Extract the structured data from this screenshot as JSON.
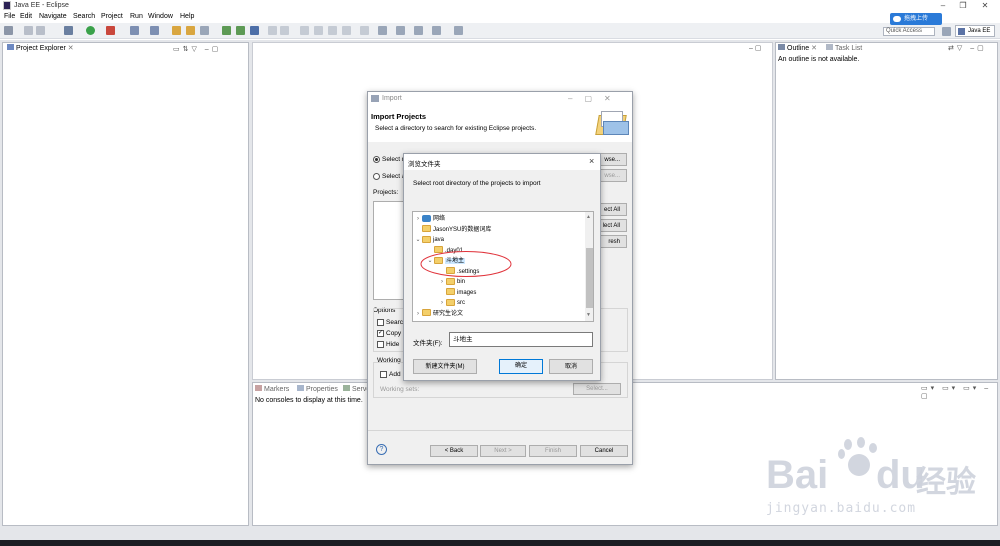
{
  "window": {
    "title": "Java EE - Eclipse"
  },
  "menu": [
    "File",
    "Edit",
    "Navigate",
    "Search",
    "Project",
    "Run",
    "Window",
    "Help"
  ],
  "toolbar": {
    "quick_access_placeholder": "Quick Access",
    "perspective": "Java EE",
    "upload_badge": "拖拽上传"
  },
  "project_explorer": {
    "title": "Project Explorer"
  },
  "outline": {
    "tab_outline": "Outline",
    "tab_tasks": "Task List",
    "message": "An outline is not available."
  },
  "console": {
    "tab_markers": "Markers",
    "tab_properties": "Properties",
    "tab_servers": "Serve",
    "message": "No consoles to display at this time."
  },
  "import_dialog": {
    "window_title": "Import",
    "heading": "Import Projects",
    "subtitle": "Select a directory to search for existing Eclipse projects.",
    "radio_root": "Select r",
    "radio_archive": "Select a",
    "browse1": "wse...",
    "browse2": "wse...",
    "projects_label": "Projects:",
    "select_all": "ect All",
    "deselect_all": "lect All",
    "refresh": "resh",
    "options_label": "Options",
    "opt_search": "Searc",
    "opt_copy": "Copy",
    "opt_hide": "Hide",
    "working_label": "Working",
    "add_label": "Add",
    "working_sets": "Working sets:",
    "select_btn": "Select...",
    "back": "< Back",
    "next": "Next >",
    "finish": "Finish",
    "cancel": "Cancel",
    "help": "?"
  },
  "browse_dialog": {
    "title": "浏览文件夹",
    "prompt": "Select root directory of the projects to import",
    "tree": [
      {
        "label": "网络",
        "arrow": "›",
        "icon": "network-icon"
      },
      {
        "label": "JasonYSU的数据词库",
        "arrow": "",
        "icon": "folder-icon"
      },
      {
        "label": "java",
        "arrow": "⌄",
        "icon": "folder-icon"
      },
      {
        "label": ".day01",
        "arrow": "",
        "icon": "folder-icon"
      },
      {
        "label": "斗地主",
        "arrow": "⌄",
        "icon": "folder-icon",
        "selected": true
      },
      {
        "label": ".settings",
        "arrow": "",
        "icon": "folder-icon"
      },
      {
        "label": "bin",
        "arrow": "›",
        "icon": "folder-icon"
      },
      {
        "label": "images",
        "arrow": "",
        "icon": "folder-icon"
      },
      {
        "label": "src",
        "arrow": "›",
        "icon": "folder-icon"
      },
      {
        "label": "研究生论文",
        "arrow": "›",
        "icon": "folder-icon"
      }
    ],
    "folder_label": "文件夹(F):",
    "folder_value": "斗地主",
    "new_folder": "新建文件夹(M)",
    "ok": "确定",
    "cancel": "取消",
    "close": "×"
  },
  "watermark": {
    "brand": "Bai",
    "brand2": "du",
    "cn": "经验",
    "url": "jingyan.baidu.com"
  },
  "colors": {
    "selection": "#cce8ff",
    "annotation": "#e0323a",
    "accent": "#2a7ad8"
  }
}
